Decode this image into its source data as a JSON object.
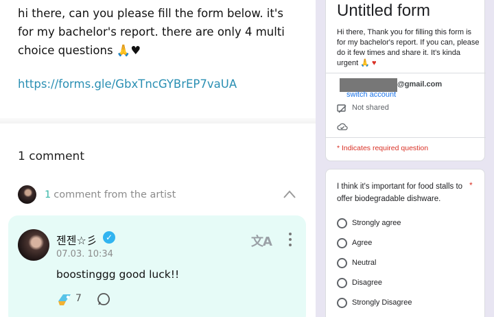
{
  "post": {
    "text": "hi there, can you please fill the form below. it's for my bachelor's report. there are only 4 multi choice questions 🙏♥",
    "link": "https://forms.gle/GbxTncGYBrEP7vaUA"
  },
  "comments": {
    "count_label": "1 comment",
    "artist_count": "1",
    "artist_label": "comment from the artist"
  },
  "comment": {
    "author": "젠젠☆彡",
    "date": "07.03. 10:34",
    "text": "boostinggg good luck!!",
    "boost_count": "7"
  },
  "form": {
    "title": "Untitled form",
    "description": "Hi there, Thank you for filling this form is for my bachelor's report. If you can, please do it few times and share it. It's kinda urgent 🙏",
    "heart": "♥",
    "email_suffix": "@gmail.com",
    "switch_account": "switch account",
    "not_shared": "Not shared",
    "required_note": "* Indicates required question",
    "question": "I think it's important for food stalls to offer biodegradable dishware.",
    "required_star": "*",
    "options": [
      "Strongly agree",
      "Agree",
      "Neutral",
      "Disagree",
      "Strongly Disagree"
    ]
  },
  "colors": {
    "link": "#2a8fb3",
    "comment_bg": "#e6fbf7",
    "accent_teal": "#38b7a8",
    "required_red": "#d93025",
    "form_bg": "#e8e5f2"
  }
}
